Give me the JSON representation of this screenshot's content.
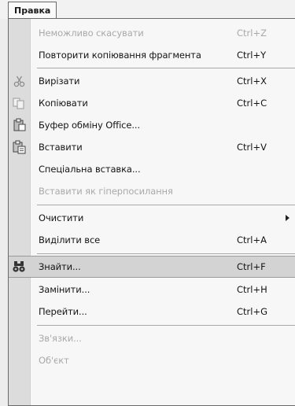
{
  "menubar": {
    "edit_menu": "Правка"
  },
  "menu": {
    "items": [
      {
        "label": "Неможливо скасувати",
        "shortcut": "Ctrl+Z",
        "disabled": true,
        "icon": "undo-icon"
      },
      {
        "label": "Повторити копіювання фрагмента",
        "shortcut": "Ctrl+Y",
        "disabled": false,
        "icon": "redo-icon"
      },
      {
        "label": "Вирізати",
        "shortcut": "Ctrl+X",
        "disabled": false,
        "icon": "cut-icon"
      },
      {
        "label": "Копіювати",
        "shortcut": "Ctrl+C",
        "disabled": false,
        "icon": "copy-icon"
      },
      {
        "label": "Буфер обміну Office...",
        "shortcut": "",
        "disabled": false,
        "icon": "clipboard-icon"
      },
      {
        "label": "Вставити",
        "shortcut": "Ctrl+V",
        "disabled": false,
        "icon": "paste-icon"
      },
      {
        "label": "Спеціальна вставка...",
        "shortcut": "",
        "disabled": false,
        "icon": ""
      },
      {
        "label": "Вставити як гіперпосилання",
        "shortcut": "",
        "disabled": true,
        "icon": ""
      },
      {
        "label": "Очистити",
        "shortcut": "",
        "disabled": false,
        "icon": "",
        "submenu": true
      },
      {
        "label": "Виділити все",
        "shortcut": "Ctrl+A",
        "disabled": false,
        "icon": ""
      },
      {
        "label": "Знайти...",
        "shortcut": "Ctrl+F",
        "disabled": false,
        "icon": "binoculars-icon",
        "highlighted": true
      },
      {
        "label": "Замінити...",
        "shortcut": "Ctrl+H",
        "disabled": false,
        "icon": ""
      },
      {
        "label": "Перейти...",
        "shortcut": "Ctrl+G",
        "disabled": false,
        "icon": ""
      },
      {
        "label": "Зв'язки...",
        "shortcut": "",
        "disabled": true,
        "icon": ""
      },
      {
        "label": "Об'єкт",
        "shortcut": "",
        "disabled": true,
        "icon": ""
      }
    ]
  },
  "colors": {
    "menu_background": "#f7f7f7",
    "gutter": "#dcdcdc",
    "highlight": "#d3d3d3",
    "disabled_text": "#a9a9a9",
    "border": "#6a6a6a"
  }
}
